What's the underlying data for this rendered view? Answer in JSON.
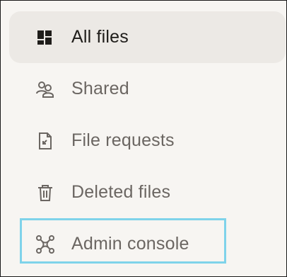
{
  "sidebar": {
    "items": [
      {
        "label": "All files",
        "icon": "all-files-icon",
        "active": true
      },
      {
        "label": "Shared",
        "icon": "shared-users-icon",
        "active": false
      },
      {
        "label": "File requests",
        "icon": "file-request-icon",
        "active": false
      },
      {
        "label": "Deleted files",
        "icon": "trash-icon",
        "active": false
      },
      {
        "label": "Admin console",
        "icon": "admin-console-icon",
        "active": false
      }
    ]
  },
  "colors": {
    "background": "#f7f5f2",
    "active_bg": "#ece9e5",
    "active_text": "#1f1d1a",
    "inactive_text": "#6b6662",
    "highlight_border": "#7fd3ea"
  }
}
